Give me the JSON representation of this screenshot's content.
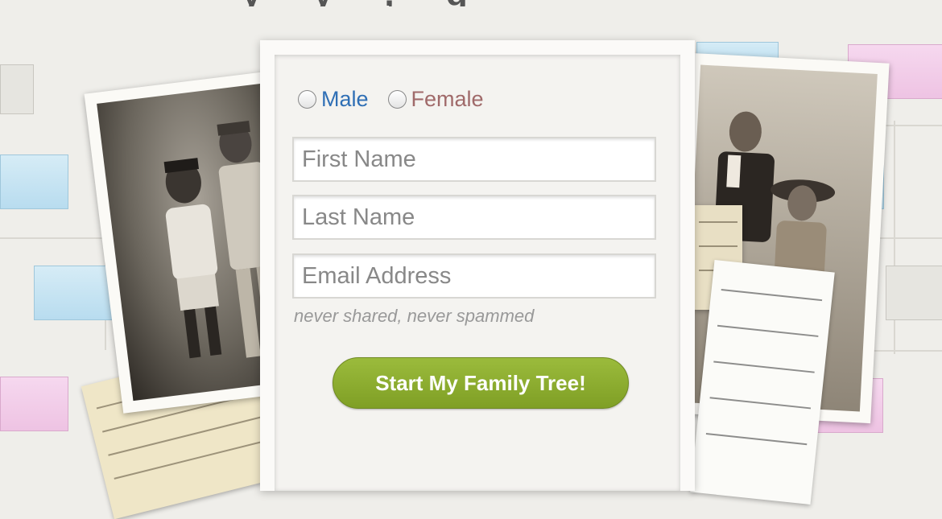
{
  "header": {
    "fragment": "y y ,  g"
  },
  "form": {
    "gender": {
      "male_label": "Male",
      "female_label": "Female"
    },
    "first_name": {
      "placeholder": "First Name",
      "value": ""
    },
    "last_name": {
      "placeholder": "Last Name",
      "value": ""
    },
    "email": {
      "placeholder": "Email Address",
      "value": ""
    },
    "privacy_note": "never shared, never spammed",
    "submit_label": "Start My Family Tree!"
  },
  "colors": {
    "male_text": "#2f6fb5",
    "female_text": "#a06a6a",
    "button_green": "#8aab30",
    "tree_box_blue": "#c7e4f3",
    "tree_box_pink": "#f2cdea"
  },
  "decor": {
    "left_photo": "vintage-photo-two-boys",
    "right_photo": "vintage-photo-couple",
    "documents": "handwritten-records"
  }
}
